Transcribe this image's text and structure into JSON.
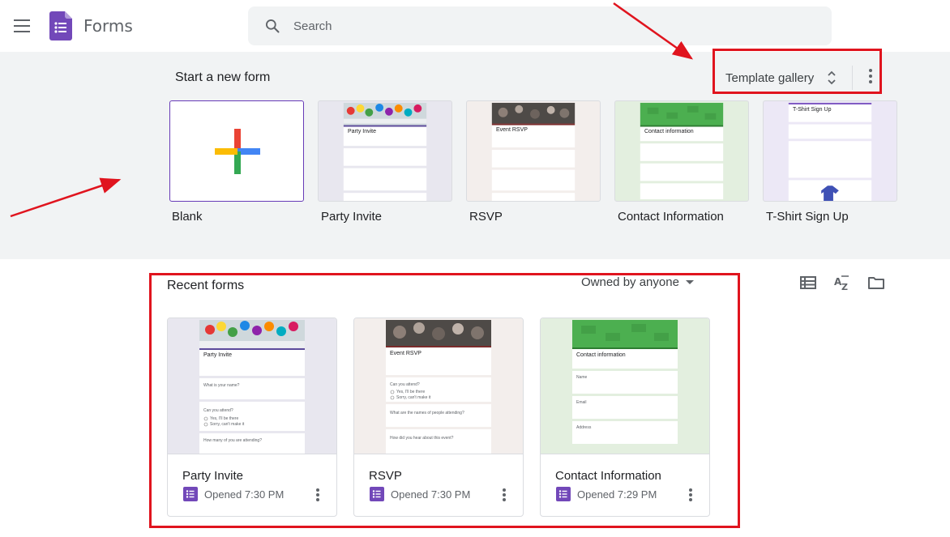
{
  "header": {
    "app_title": "Forms",
    "search_placeholder": "Search"
  },
  "templates": {
    "section_title": "Start a new form",
    "gallery_label": "Template gallery",
    "items": [
      {
        "label": "Blank"
      },
      {
        "label": "Party Invite",
        "preview_title": "Party Invite",
        "accent": "#5c4b9b",
        "bg": "#e8e7ef"
      },
      {
        "label": "RSVP",
        "preview_title": "Event RSVP",
        "accent": "#7b2b2b",
        "bg": "#f3eeec"
      },
      {
        "label": "Contact Information",
        "preview_title": "Contact information",
        "accent": "#4caf50",
        "bg": "#e3efdf"
      },
      {
        "label": "T-Shirt Sign Up",
        "preview_title": "T-Shirt Sign Up",
        "accent": "#7e57c2",
        "bg": "#ece8f6"
      }
    ]
  },
  "recent": {
    "section_title": "Recent forms",
    "owner_filter": "Owned by anyone",
    "items": [
      {
        "name": "Party Invite",
        "opened": "Opened 7:30 PM",
        "preview_title": "Party Invite",
        "q1": "What is your name?",
        "q2": "Can you attend?",
        "opt1": "Yes, I'll be there",
        "opt2": "Sorry, can't make it",
        "q3": "How many of you are attending?"
      },
      {
        "name": "RSVP",
        "opened": "Opened 7:30 PM",
        "preview_title": "Event RSVP",
        "q1": "Can you attend?",
        "q2": "What are the names of people attending?",
        "opt1": "Yes, I'll be there",
        "opt2": "Sorry, can't make it",
        "q3": "How did you hear about this event?"
      },
      {
        "name": "Contact Information",
        "opened": "Opened 7:29 PM",
        "preview_title": "Contact information",
        "q1": "Name",
        "q2": "Email",
        "q3": "Address"
      }
    ]
  },
  "colors": {
    "brand_purple": "#673ab7",
    "annotation_red": "#e0141e",
    "plus_red": "#ea4335",
    "plus_blue": "#4285f4",
    "plus_yellow": "#fbbc04",
    "plus_green": "#34a853"
  }
}
